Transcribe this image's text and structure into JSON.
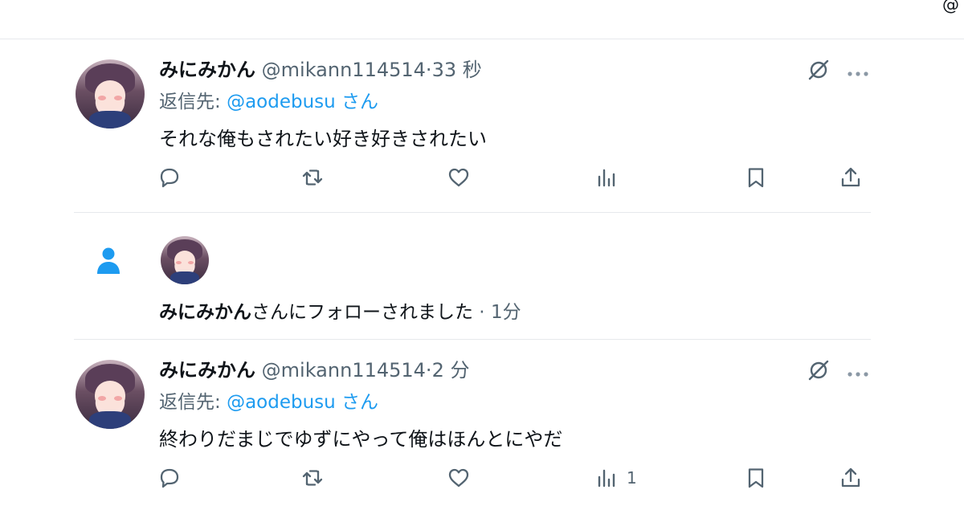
{
  "top_icon": "@",
  "tweets": [
    {
      "name": "みにみかん",
      "handle": "@mikann114514",
      "dot": "·",
      "time": "33 秒",
      "replying_prefix": "返信先: ",
      "replying_mention": "@aodebusu",
      "replying_suffix": " さん",
      "text": "それな俺もされたい好き好きされたい",
      "views": ""
    },
    {
      "name": "みにみかん",
      "handle": "@mikann114514",
      "dot": "·",
      "time": "2 分",
      "replying_prefix": "返信先: ",
      "replying_mention": "@aodebusu",
      "replying_suffix": " さん",
      "text": "終わりだまじでゆずにやって俺はほんとにやだ",
      "views": "1"
    }
  ],
  "follow": {
    "name": "みにみかん",
    "message": "さんにフォローされました",
    "separator": " · ",
    "time": "1分"
  },
  "colors": {
    "accent": "#1d9bf0",
    "text": "#0f1419",
    "muted": "#536471",
    "border": "#e6e9ec"
  },
  "icons": [
    "at-icon",
    "grok-icon",
    "more-icon",
    "reply-icon",
    "retweet-icon",
    "like-icon",
    "views-icon",
    "bookmark-icon",
    "share-icon",
    "person-icon"
  ]
}
